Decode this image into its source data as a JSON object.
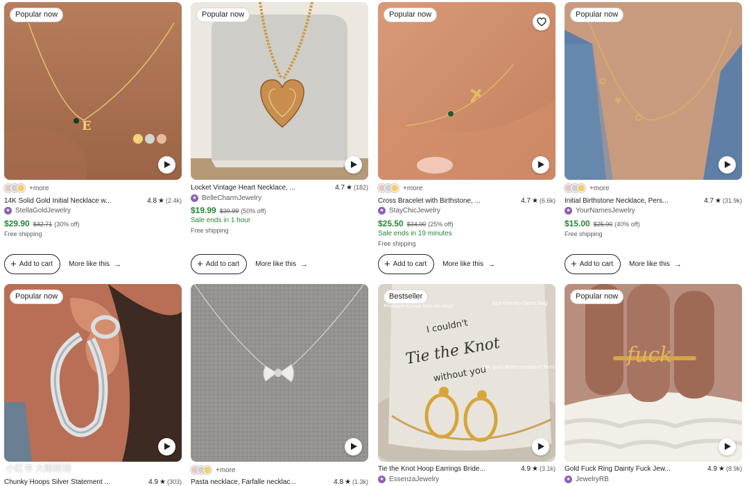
{
  "listings": [
    {
      "badge": "Popular now",
      "variants_more": "+more",
      "swatches": [
        "#e7c7c4",
        "#d0d0d0",
        "#f2cf6c"
      ],
      "title": "14K Solid Gold Initial Necklace w...",
      "rating": "4.8",
      "reviews": "(2.4k)",
      "shop": "StellaGoldJewelry",
      "price": "$29.90",
      "original_price": "$42.71",
      "discount": "(30% off)",
      "shipping": "Free shipping",
      "add_to_cart": "Add to cart",
      "more_like": "More like this",
      "image_icon": "gold-initial-necklace-photo"
    },
    {
      "badge": "Popular now",
      "title": "Locket Vintage Heart Necklace, ...",
      "rating": "4.7",
      "reviews": "(182)",
      "shop": "BelleCharmJewelry",
      "price": "$19.99",
      "original_price": "$39.99",
      "discount": "(50% off)",
      "sale_ends": "Sale ends in 1 hour",
      "shipping": "Free shipping",
      "add_to_cart": "Add to cart",
      "more_like": "More like this",
      "image_icon": "heart-locket-photo"
    },
    {
      "badge": "Popular now",
      "variants_more": "+more",
      "swatches": [
        "#e7c7c4",
        "#d0d0d0",
        "#f2cf6c"
      ],
      "title": "Cross Bracelet with Birthstone, ...",
      "rating": "4.7",
      "reviews": "(6.6k)",
      "shop": "StayChicJewelry",
      "price": "$25.50",
      "original_price": "$34.00",
      "discount": "(25% off)",
      "sale_ends": "Sale ends in 19 minutes",
      "shipping": "Free shipping",
      "add_to_cart": "Add to cart",
      "more_like": "More like this",
      "image_icon": "cross-bracelet-photo"
    },
    {
      "badge": "Popular now",
      "variants_more": "+more",
      "swatches": [
        "#e7c7c4",
        "#d0d0d0",
        "#f2cf6c"
      ],
      "title": "Initial Birthstone Necklace, Pers...",
      "rating": "4.7",
      "reviews": "(31.9k)",
      "shop": "YourNamesJewelry",
      "price": "$15.00",
      "original_price": "$25.00",
      "discount": "(40% off)",
      "shipping": "Free shipping",
      "add_to_cart": "Add to cart",
      "more_like": "More like this",
      "image_icon": "initial-birthstone-necklace-photo"
    },
    {
      "badge": "Popular now",
      "title": "Chunky Hoops Silver Statement ...",
      "rating": "4.9",
      "reviews": "(303)",
      "image_icon": "silver-hoop-earring-photo"
    },
    {
      "variants_more": "+more",
      "swatches": [
        "#e7c7c4",
        "#d0d0d0",
        "#f2cf6c"
      ],
      "title": "Pasta necklace, Farfalle necklac...",
      "rating": "4.8",
      "reviews": "(1.3k)",
      "image_icon": "bowtie-pasta-necklace-photo"
    },
    {
      "badge": "Bestseller",
      "title": "Tie the Knot Hoop Earrings Bride...",
      "rating": "4.9",
      "reviews": "(3.1k)",
      "shop": "EssenzaJewelry",
      "image_icon": "knot-hoop-earrings-photo",
      "image_text": {
        "headline_1": "I couldn't",
        "headline_2": "Tie the Knot",
        "headline_3": "without you",
        "note_left": "Premium Cricut iron-on vinyl",
        "note_right": "Eco-friendly fabric bag",
        "note_gold": "18k gold Water-resistant Tarnish-free"
      }
    },
    {
      "badge": "Popular now",
      "title": "Gold Fuck Ring Dainty Fuck Jew...",
      "rating": "4.9",
      "reviews": "(8.9k)",
      "shop": "JewelryRB",
      "image_icon": "script-word-ring-photo",
      "image_text": {
        "ring_word": "fuck"
      }
    }
  ],
  "watermark": "小红书 大眼睛镜",
  "colors": {
    "price_green": "#258635",
    "star_seller": "#8b5fb8",
    "text": "#222222",
    "muted": "#595959"
  }
}
